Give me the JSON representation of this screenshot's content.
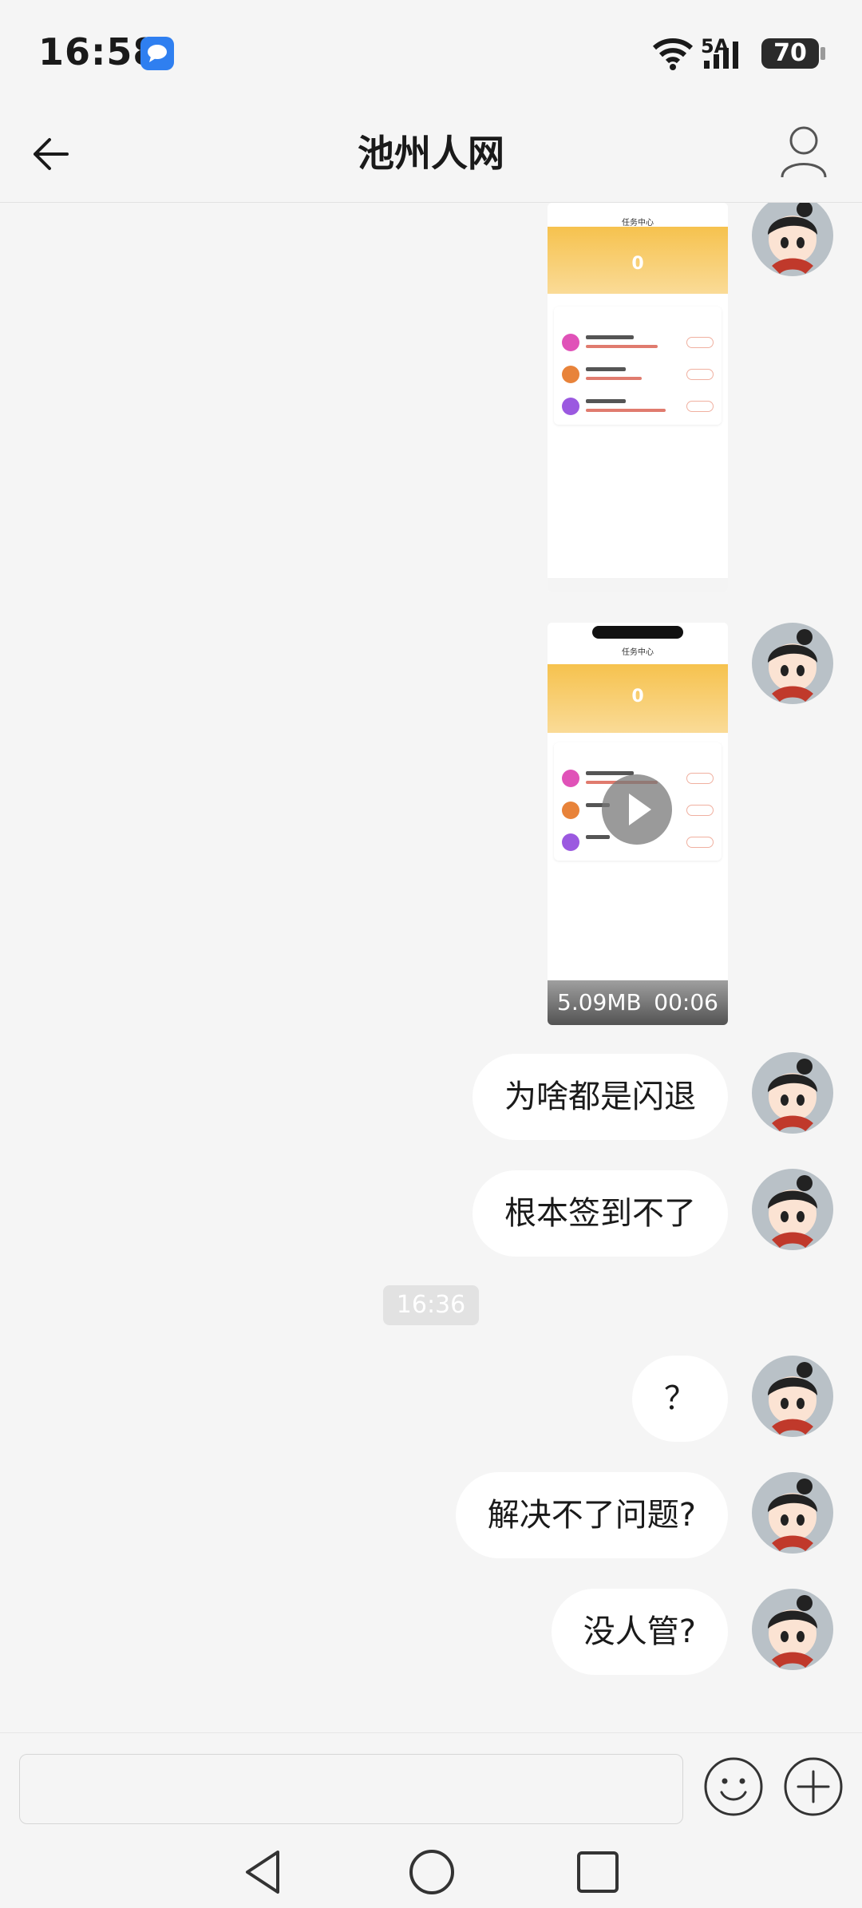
{
  "status_bar": {
    "time": "16:58",
    "network": "5A",
    "battery": "70"
  },
  "header": {
    "title": "池州人网"
  },
  "media": [
    {
      "kind": "image",
      "mini_title": "任务中心",
      "mini_value": "0"
    },
    {
      "kind": "video",
      "mini_title": "任务中心",
      "mini_value": "0",
      "size": "5.09MB",
      "duration": "00:06"
    }
  ],
  "messages": [
    {
      "text": "为啥都是闪退"
    },
    {
      "text": "根本签到不了"
    },
    {
      "text": "？"
    },
    {
      "text": "解决不了问题?"
    },
    {
      "text": "没人管?"
    }
  ],
  "timestamp": "16:36",
  "input": {
    "placeholder": ""
  },
  "colors": {
    "bubble": "#ffffff",
    "background": "#f5f5f5",
    "accent_badge": "#2f7ff0"
  }
}
